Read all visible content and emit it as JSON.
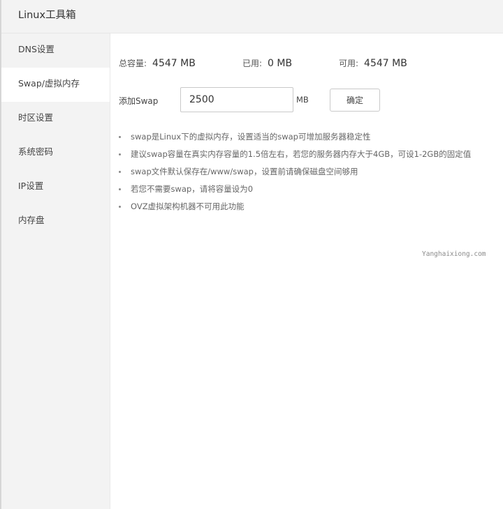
{
  "header": {
    "title": "Linux工具箱"
  },
  "sidebar": {
    "items": [
      {
        "label": "DNS设置"
      },
      {
        "label": "Swap/虚拟内存"
      },
      {
        "label": "时区设置"
      },
      {
        "label": "系统密码"
      },
      {
        "label": "IP设置"
      },
      {
        "label": "内存盘"
      }
    ],
    "active_item": "Swap/虚拟内存"
  },
  "stats": {
    "total_label": "总容量:",
    "total_value": "4547 MB",
    "used_label": "已用:",
    "used_value": "0 MB",
    "available_label": "可用:",
    "available_value": "4547 MB"
  },
  "swap": {
    "label": "添加Swap",
    "value": "2500",
    "unit": "MB",
    "confirm_label": "确定"
  },
  "tips": [
    "swap是Linux下的虚拟内存，设置适当的swap可增加服务器稳定性",
    "建议swap容量在真实内存容量的1.5倍左右，若您的服务器内存大于4GB，可设1-2GB的固定值",
    "swap文件默认保存在/www/swap，设置前请确保磁盘空间够用",
    "若您不需要swap，请将容量设为0",
    "OVZ虚拟架构机器不可用此功能"
  ],
  "watermark": "Yanghaixiong.com",
  "colors": {
    "sidebar_bg": "#f3f3f3",
    "active_bg": "#ffffff",
    "border": "#c9c9c9"
  }
}
